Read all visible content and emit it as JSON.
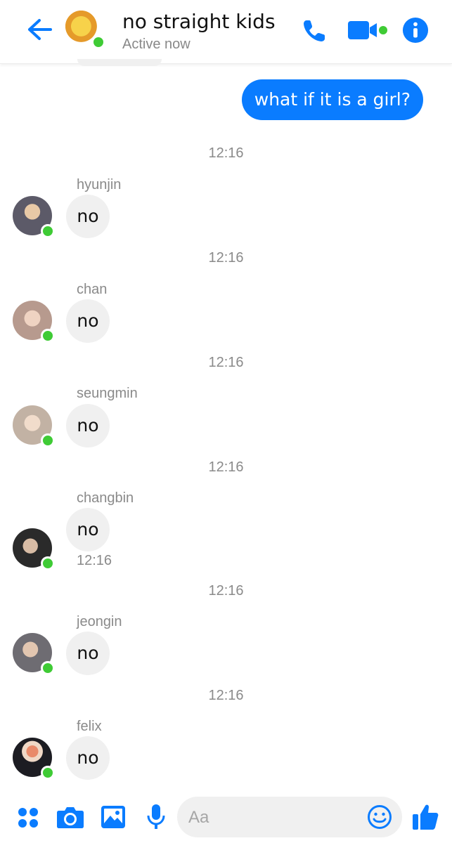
{
  "header": {
    "title": "no straight kids",
    "status": "Active now"
  },
  "outgoing": {
    "text": "what if it is a girl?"
  },
  "messages": [
    {
      "timestamp": "12:16",
      "sender": "hyunjin",
      "text": "no",
      "avatar_color": "#5c5a68"
    },
    {
      "timestamp": "12:16",
      "sender": "chan",
      "text": "no",
      "avatar_color": "#b79a8e"
    },
    {
      "timestamp": "12:16",
      "sender": "seungmin",
      "text": "no",
      "avatar_color": "#c2b2a4"
    },
    {
      "timestamp": "12:16",
      "sender": "changbin",
      "text": "no",
      "avatar_color": "#2a2a2a",
      "time_under": "12:16"
    },
    {
      "timestamp": "12:16",
      "sender": "jeongin",
      "text": "no",
      "avatar_color": "#6e6c72"
    },
    {
      "timestamp": "12:16",
      "sender": "felix",
      "text": "no",
      "avatar_color": "#8a8ea0"
    }
  ],
  "composer": {
    "placeholder": "Aa",
    "icons": [
      "apps-icon",
      "camera-icon",
      "gallery-icon",
      "microphone-icon",
      "emoji-icon",
      "thumbs-up-icon"
    ]
  },
  "colors": {
    "accent": "#0a7cff",
    "online": "#3fcb35",
    "bubble_in": "#f0f0f0"
  }
}
